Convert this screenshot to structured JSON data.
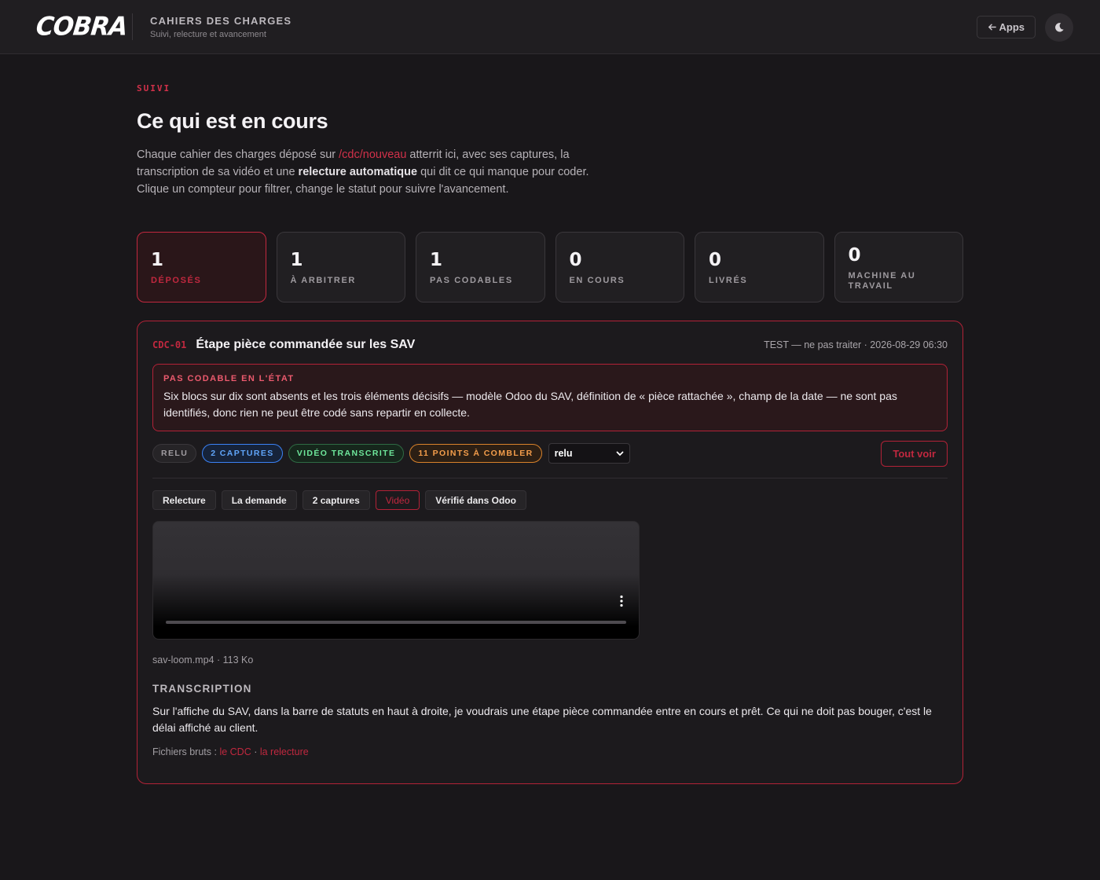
{
  "header": {
    "logo": "COBRA",
    "title": "CAHIERS DES CHARGES",
    "subtitle": "Suivi, relecture et avancement",
    "apps_label": "Apps",
    "icons": {
      "apps": "arrow-left-icon",
      "theme": "moon-icon"
    }
  },
  "page": {
    "kicker": "SUIVI",
    "title": "Ce qui est en cours",
    "intro": {
      "part1": "Chaque cahier des charges déposé sur ",
      "link": "/cdc/nouveau",
      "part2": " atterrit ici, avec ses captures, la transcription de sa vidéo et une ",
      "bold": "relecture automatique",
      "part3": " qui dit ce qui manque pour coder. Clique un compteur pour filtrer, change le statut pour suivre l'avancement."
    }
  },
  "counters": [
    {
      "value": "1",
      "label": "DÉPOSÉS",
      "active": true
    },
    {
      "value": "1",
      "label": "À ARBITRER",
      "active": false
    },
    {
      "value": "1",
      "label": "PAS CODABLES",
      "active": false
    },
    {
      "value": "0",
      "label": "EN COURS",
      "active": false
    },
    {
      "value": "0",
      "label": "LIVRÉS",
      "active": false
    },
    {
      "value": "0",
      "label": "MACHINE AU TRAVAIL",
      "active": false
    }
  ],
  "card": {
    "id": "CDC-01",
    "title": "Étape pièce commandée sur les SAV",
    "meta": "TEST — ne pas traiter · 2026-08-29 06:30",
    "alert": {
      "title": "PAS CODABLE EN L'ÉTAT",
      "text": "Six blocs sur dix sont absents et les trois éléments décisifs — modèle Odoo du SAV, définition de « pièce rattachée », champ de la date — ne sont pas identifiés, donc rien ne peut être codé sans repartir en collecte."
    },
    "tags": {
      "relu": "RELU",
      "captures": "2 CAPTURES",
      "video": "VIDÉO TRANSCRITE",
      "points": "11 POINTS À COMBLER"
    },
    "status_value": "relu",
    "view_all": "Tout voir",
    "tabs": [
      "Relecture",
      "La demande",
      "2 captures",
      "Vidéo",
      "Vérifié dans Odoo"
    ],
    "active_tab": "Vidéo",
    "file_info": "sav-loom.mp4 · 113 Ko",
    "transcription_title": "TRANSCRIPTION",
    "transcription": "Sur l'affiche du SAV, dans la barre de statuts en haut à droite, je voudrais une étape pièce commandée entre en cours et prêt. Ce qui ne doit pas bouger, c'est le délai affiché au client.",
    "raw_files": {
      "label": "Fichiers bruts : ",
      "link1": "le CDC",
      "sep": " · ",
      "link2": "la relecture"
    }
  }
}
